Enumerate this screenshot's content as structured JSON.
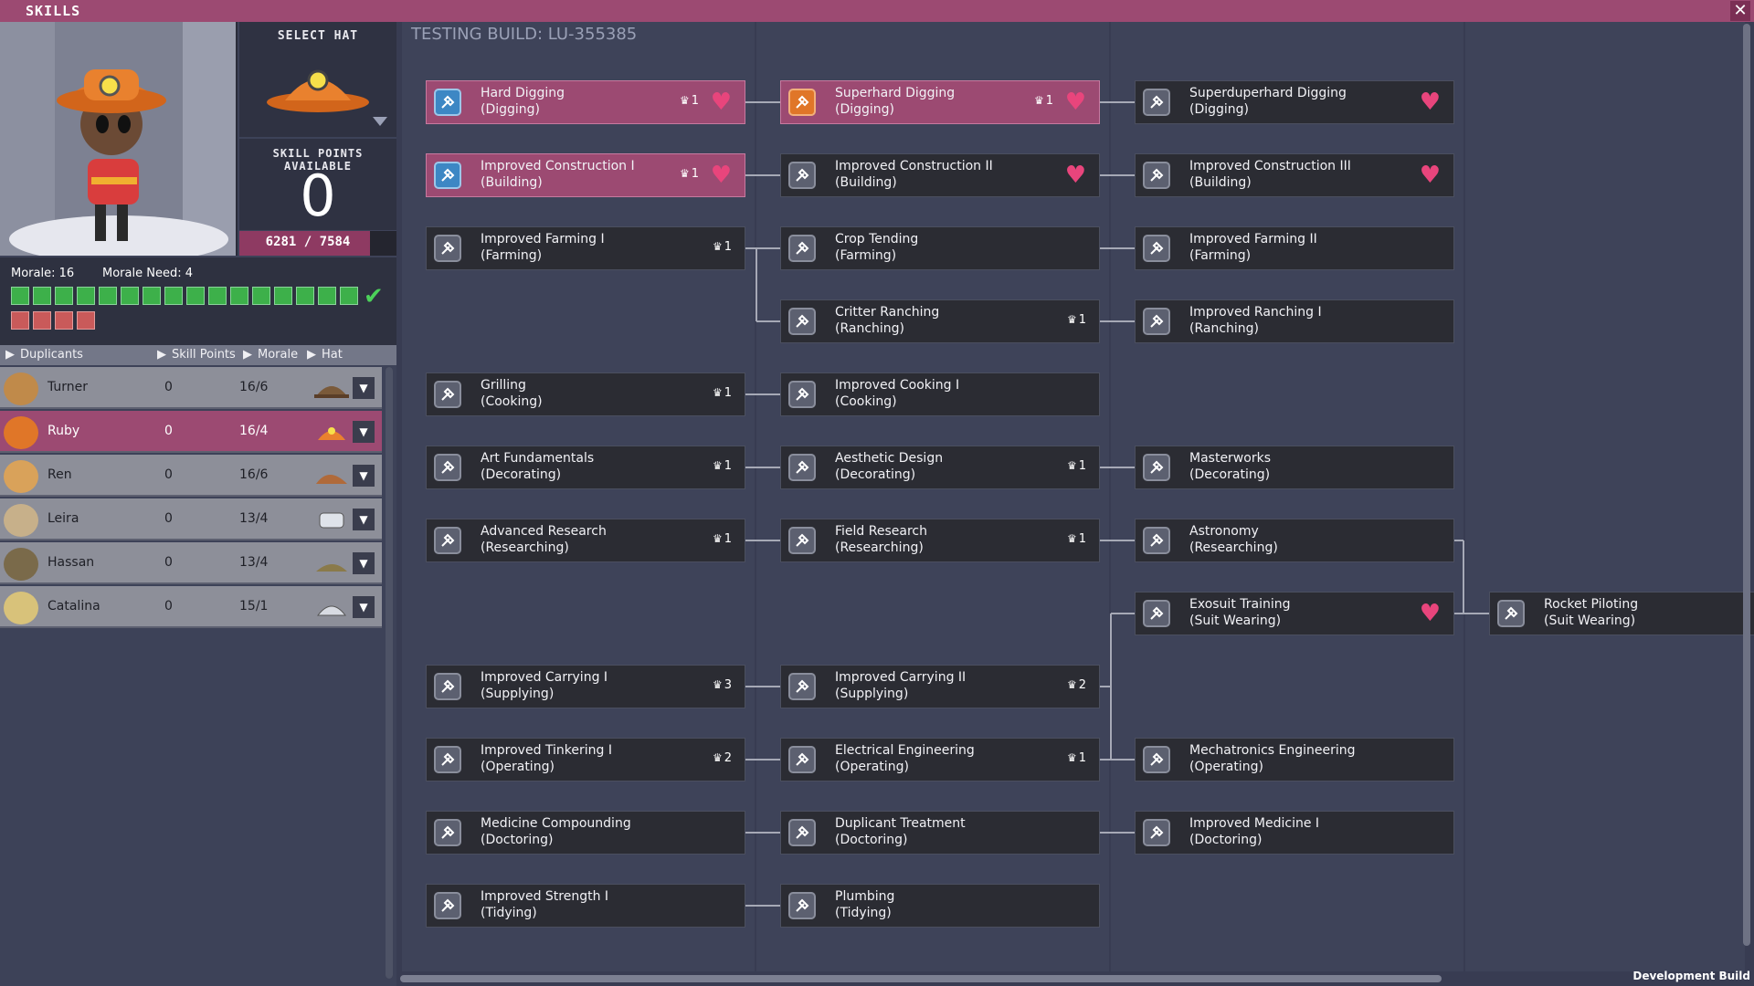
{
  "window": {
    "title": "SKILLS",
    "close_label": "✕"
  },
  "hat_panel": {
    "label": "SELECT HAT"
  },
  "skill_points": {
    "label": "SKILL POINTS AVAILABLE",
    "value": "0",
    "xp_text": "6281 / 7584",
    "xp_fraction": 0.83
  },
  "morale": {
    "label": "Morale: 16",
    "need_label": "Morale Need: 4",
    "pips_green": 16,
    "pips_red": 4
  },
  "list_header": {
    "duplicants": "Duplicants",
    "skill_points": "Skill Points",
    "morale": "Morale",
    "hat": "Hat"
  },
  "duplicants": [
    {
      "name": "Turner",
      "points": "0",
      "morale": "16/6",
      "selected": false
    },
    {
      "name": "Ruby",
      "points": "0",
      "morale": "16/4",
      "selected": true
    },
    {
      "name": "Ren",
      "points": "0",
      "morale": "16/6",
      "selected": false
    },
    {
      "name": "Leira",
      "points": "0",
      "morale": "13/4",
      "selected": false
    },
    {
      "name": "Hassan",
      "points": "0",
      "morale": "13/4",
      "selected": false
    },
    {
      "name": "Catalina",
      "points": "0",
      "morale": "15/1",
      "selected": false
    }
  ],
  "build_label": "TESTING BUILD: LU-355385",
  "dev_label": "Development Build",
  "skills": {
    "hard_digging": {
      "name": "Hard Digging",
      "cat": "(Digging)",
      "count": "1"
    },
    "superhard_digging": {
      "name": "Superhard Digging",
      "cat": "(Digging)",
      "count": "1"
    },
    "superduperhard_digging": {
      "name": "Superduperhard Digging",
      "cat": "(Digging)"
    },
    "construction_1": {
      "name": "Improved Construction I",
      "cat": "(Building)",
      "count": "1"
    },
    "construction_2": {
      "name": "Improved Construction II",
      "cat": "(Building)"
    },
    "construction_3": {
      "name": "Improved Construction III",
      "cat": "(Building)"
    },
    "farming_1": {
      "name": "Improved Farming I",
      "cat": "(Farming)",
      "count": "1"
    },
    "crop_tending": {
      "name": "Crop Tending",
      "cat": "(Farming)"
    },
    "farming_2": {
      "name": "Improved Farming II",
      "cat": "(Farming)"
    },
    "critter_ranching": {
      "name": "Critter Ranching",
      "cat": "(Ranching)",
      "count": "1"
    },
    "ranching_1": {
      "name": "Improved Ranching I",
      "cat": "(Ranching)"
    },
    "grilling": {
      "name": "Grilling",
      "cat": "(Cooking)",
      "count": "1"
    },
    "cooking_1": {
      "name": "Improved Cooking I",
      "cat": "(Cooking)"
    },
    "art_fundamentals": {
      "name": "Art Fundamentals",
      "cat": "(Decorating)",
      "count": "1"
    },
    "aesthetic_design": {
      "name": "Aesthetic Design",
      "cat": "(Decorating)",
      "count": "1"
    },
    "masterworks": {
      "name": "Masterworks",
      "cat": "(Decorating)"
    },
    "advanced_research": {
      "name": "Advanced Research",
      "cat": "(Researching)",
      "count": "1"
    },
    "field_research": {
      "name": "Field Research",
      "cat": "(Researching)",
      "count": "1"
    },
    "astronomy": {
      "name": "Astronomy",
      "cat": "(Researching)"
    },
    "exosuit_training": {
      "name": "Exosuit Training",
      "cat": "(Suit Wearing)"
    },
    "rocket_piloting": {
      "name": "Rocket Piloting",
      "cat": "(Suit Wearing)"
    },
    "carrying_1": {
      "name": "Improved Carrying I",
      "cat": "(Supplying)",
      "count": "3"
    },
    "carrying_2": {
      "name": "Improved Carrying II",
      "cat": "(Supplying)",
      "count": "2"
    },
    "tinkering_1": {
      "name": "Improved Tinkering I",
      "cat": "(Operating)",
      "count": "2"
    },
    "electrical_engineering": {
      "name": "Electrical Engineering",
      "cat": "(Operating)",
      "count": "1"
    },
    "mechatronics": {
      "name": "Mechatronics Engineering",
      "cat": "(Operating)"
    },
    "medicine_compounding": {
      "name": "Medicine Compounding",
      "cat": "(Doctoring)"
    },
    "duplicant_treatment": {
      "name": "Duplicant Treatment",
      "cat": "(Doctoring)"
    },
    "medicine_1": {
      "name": "Improved Medicine I",
      "cat": "(Doctoring)"
    },
    "strength_1": {
      "name": "Improved Strength I",
      "cat": "(Tidying)"
    },
    "plumbing": {
      "name": "Plumbing",
      "cat": "(Tidying)"
    }
  },
  "colors": {
    "accent": "#9c4a72",
    "heart": "#e8457c",
    "morale_green": "#3db04a",
    "morale_red": "#c95a5a"
  }
}
